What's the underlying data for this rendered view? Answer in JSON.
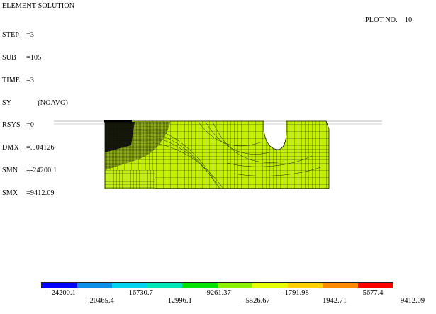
{
  "header": {
    "title": "ELEMENT SOLUTION",
    "plot_no_label": "PLOT NO.",
    "plot_no_value": "10"
  },
  "info": [
    {
      "key": "STEP",
      "value": "=3"
    },
    {
      "key": "SUB",
      "value": "=105"
    },
    {
      "key": "TIME",
      "value": "=3"
    },
    {
      "key": "SY",
      "value": "      (NOAVG)"
    },
    {
      "key": "RSYS",
      "value": "=0"
    },
    {
      "key": "DMX",
      "value": "=.004126"
    },
    {
      "key": "SMN",
      "value": "=-24200.1"
    },
    {
      "key": "SMX",
      "value": "=9412.09"
    }
  ],
  "legend": {
    "colors": [
      "#0000ff",
      "#0d91e9",
      "#00d5ef",
      "#00e6b8",
      "#00e400",
      "#8cf200",
      "#e6ff00",
      "#ffd200",
      "#ff8c00",
      "#ff0000"
    ],
    "labels_row1": [
      "-24200.1",
      "-16730.7",
      "-9261.37",
      "-1791.98",
      "5677.4"
    ],
    "labels_row2": [
      "-20465.4",
      "-12996.1",
      "-5526.67",
      "1942.71",
      "9412.09"
    ]
  },
  "colors": {
    "mesh_fill": "#c5f000",
    "mesh_line": "#1a2a00",
    "dense_mesh": "#0a0a0a"
  }
}
